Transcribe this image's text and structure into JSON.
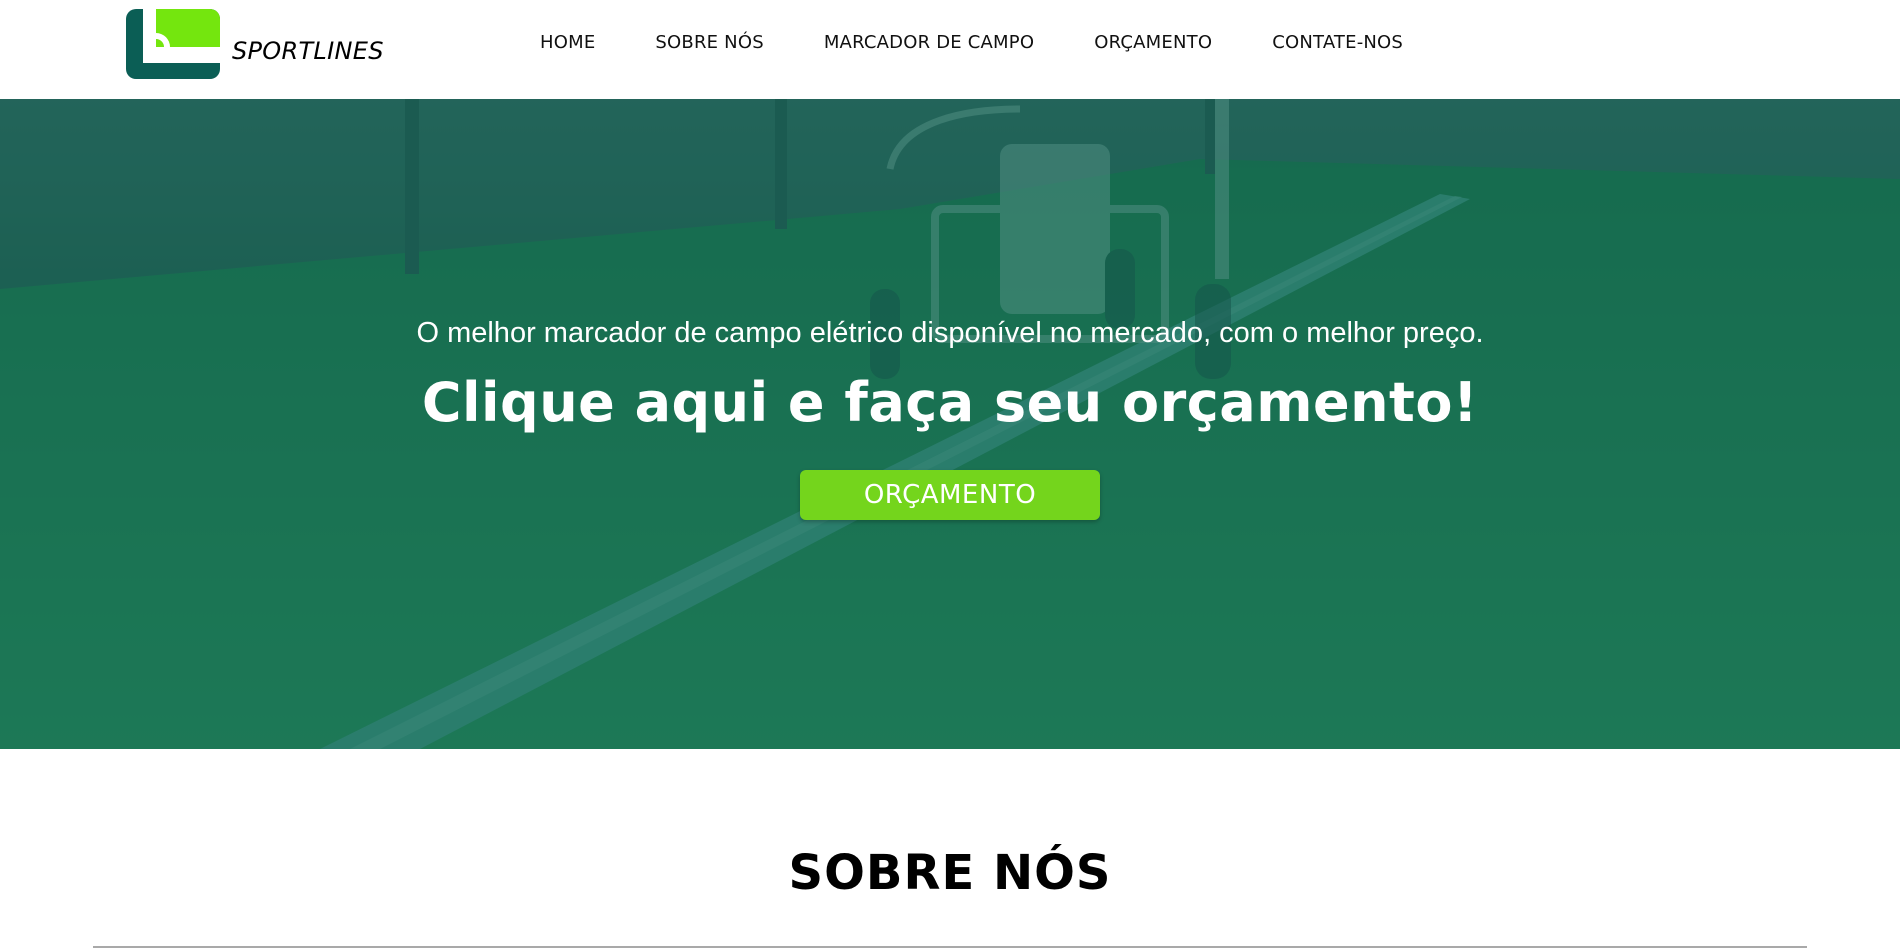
{
  "header": {
    "brand": "SPORTLINES",
    "logo_icon": "sportlines-logo-icon",
    "nav": [
      {
        "label": "HOME"
      },
      {
        "label": "SOBRE NÓS"
      },
      {
        "label": "MARCADOR DE CAMPO"
      },
      {
        "label": "ORÇAMENTO"
      },
      {
        "label": "CONTATE-NOS"
      }
    ]
  },
  "hero": {
    "subtitle": "O melhor marcador de campo elétrico disponível no mercado, com o melhor preço.",
    "title": "Clique aqui e faça seu orçamento!",
    "button_label": "ORÇAMENTO"
  },
  "about": {
    "title": "SOBRE NÓS"
  },
  "colors": {
    "accent_green": "#74d51c",
    "brand_dark_green": "#0b5e55",
    "hero_overlay": "#0e5c52"
  }
}
